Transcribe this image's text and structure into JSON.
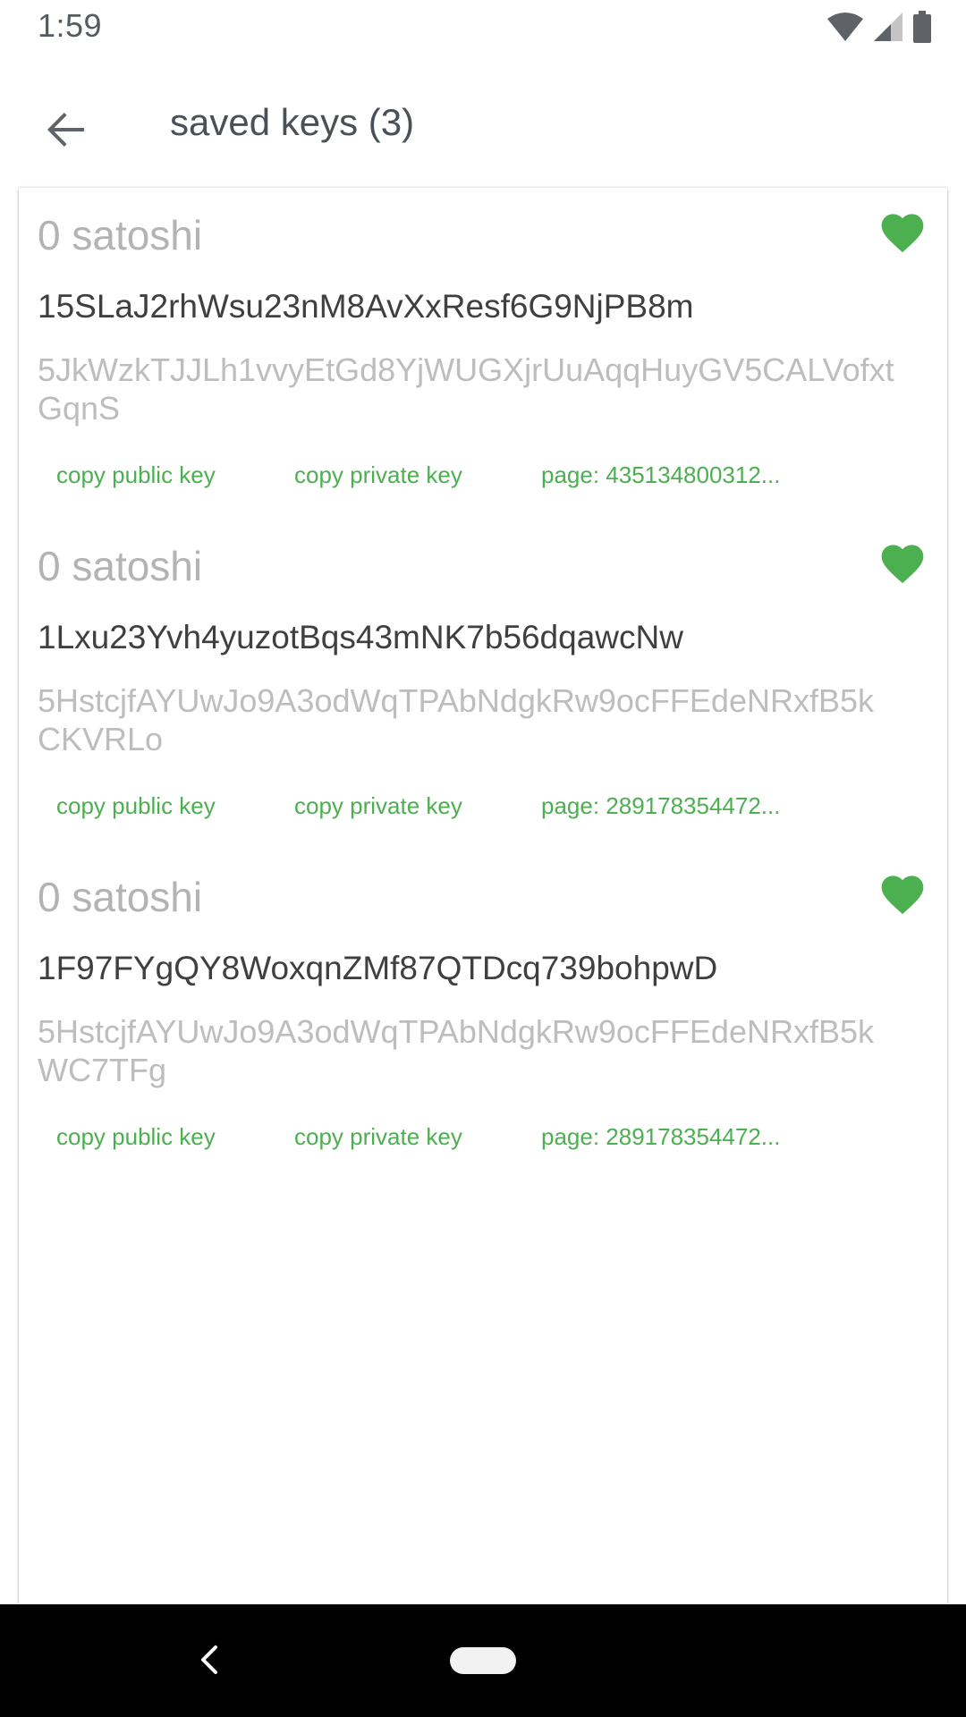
{
  "status_bar": {
    "time": "1:59",
    "icons": [
      "wifi-icon",
      "cellular-signal-icon",
      "battery-icon"
    ]
  },
  "app_bar": {
    "title": "saved keys (3)",
    "back_icon": "arrow-back-icon"
  },
  "colors": {
    "accent": "#4caf50",
    "title_text": "#4a5056",
    "balance_text": "#b3b3b3",
    "address_text": "#3f3f3f",
    "private_key_text": "#bdbdbd"
  },
  "keys": [
    {
      "balance": "0 satoshi",
      "address": "15SLaJ2rhWsu23nM8AvXxResf6G9NjPB8m",
      "private_key": "5JkWzkTJJLh1vvyEtGd8YjWUGXjrUuAqqHuyGV5CALVofxtGqnS",
      "copy_public_label": "copy public key",
      "copy_private_label": "copy private key",
      "page_label": "page: 435134800312...",
      "favorite_icon": "heart-icon"
    },
    {
      "balance": "0 satoshi",
      "address": "1Lxu23Yvh4yuzotBqs43mNK7b56dqawcNw",
      "private_key": "5HstcjfAYUwJo9A3odWqTPAbNdgkRw9ocFFEdeNRxfB5kCKVRLo",
      "copy_public_label": "copy public key",
      "copy_private_label": "copy private key",
      "page_label": "page: 289178354472...",
      "favorite_icon": "heart-icon"
    },
    {
      "balance": "0 satoshi",
      "address": "1F97FYgQY8WoxqnZMf87QTDcq739bohpwD",
      "private_key": "5HstcjfAYUwJo9A3odWqTPAbNdgkRw9ocFFEdeNRxfB5kWC7TFg",
      "copy_public_label": "copy public key",
      "copy_private_label": "copy private key",
      "page_label": "page: 289178354472...",
      "favorite_icon": "heart-icon"
    }
  ],
  "nav_bar": {
    "back_icon": "nav-back-icon",
    "home_icon": "nav-home-pill"
  }
}
